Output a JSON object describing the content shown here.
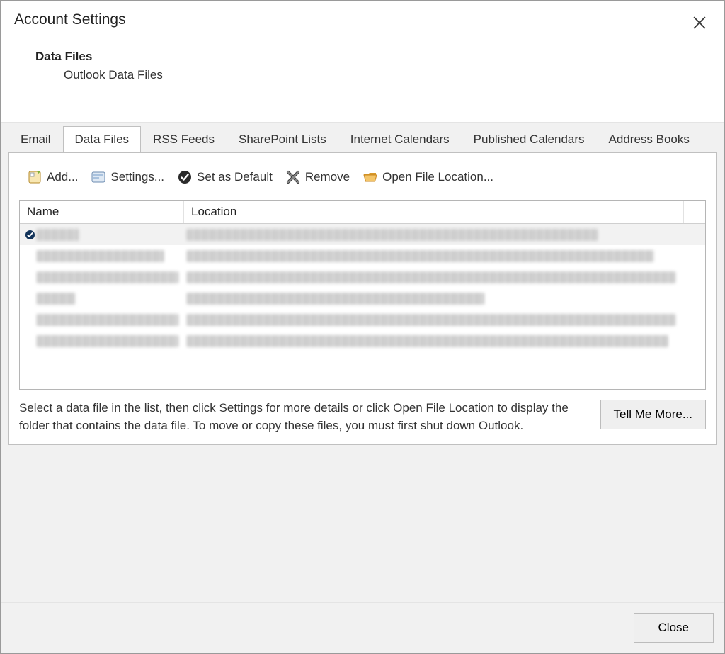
{
  "window": {
    "title": "Account Settings"
  },
  "section": {
    "heading": "Data Files",
    "sub": "Outlook Data Files"
  },
  "tabs": [
    {
      "id": "email",
      "label": "Email",
      "active": false
    },
    {
      "id": "datafiles",
      "label": "Data Files",
      "active": true
    },
    {
      "id": "rss",
      "label": "RSS Feeds",
      "active": false
    },
    {
      "id": "splists",
      "label": "SharePoint Lists",
      "active": false
    },
    {
      "id": "ical",
      "label": "Internet Calendars",
      "active": false
    },
    {
      "id": "pubcal",
      "label": "Published Calendars",
      "active": false
    },
    {
      "id": "abooks",
      "label": "Address Books",
      "active": false
    }
  ],
  "toolbar": {
    "add": "Add...",
    "settings": "Settings...",
    "default": "Set as Default",
    "remove": "Remove",
    "openloc": "Open File Location..."
  },
  "columns": {
    "name": "Name",
    "location": "Location"
  },
  "rows": [
    {
      "default": true,
      "name_redacted": true,
      "name_w": 60,
      "loc_redacted": true,
      "loc_w": 580
    },
    {
      "default": false,
      "name_redacted": true,
      "name_w": 180,
      "loc_redacted": true,
      "loc_w": 660
    },
    {
      "default": false,
      "name_redacted": true,
      "name_w": 200,
      "loc_redacted": true,
      "loc_w": 690
    },
    {
      "default": false,
      "name_redacted": true,
      "name_w": 55,
      "loc_redacted": true,
      "loc_w": 420
    },
    {
      "default": false,
      "name_redacted": true,
      "name_w": 200,
      "loc_redacted": true,
      "loc_w": 690
    },
    {
      "default": false,
      "name_redacted": true,
      "name_w": 200,
      "loc_redacted": true,
      "loc_w": 680
    }
  ],
  "help": {
    "text": "Select a data file in the list, then click Settings for more details or click Open File Location to display the folder that contains the data file. To move or copy these files, you must first shut down Outlook.",
    "more": "Tell Me More..."
  },
  "footer": {
    "close": "Close"
  }
}
